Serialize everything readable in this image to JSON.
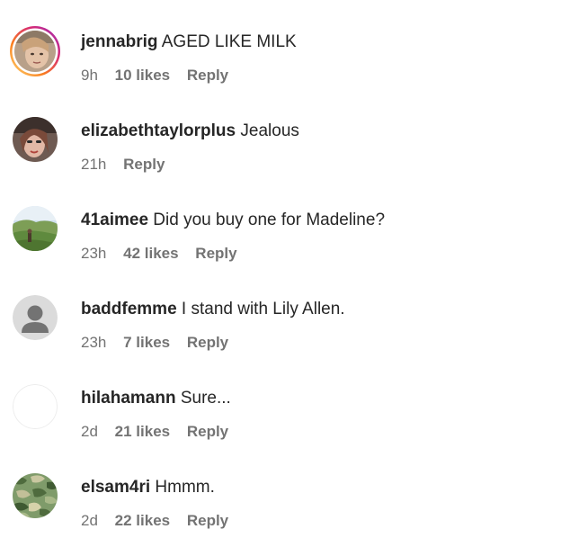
{
  "comments": [
    {
      "username": "jennabrig",
      "text": "AGED LIKE MILK",
      "time": "9h",
      "likes": "10 likes",
      "reply": "Reply",
      "avatar_icon": "profile-photo-story-ring-icon",
      "has_story_ring": true,
      "story_ring_colors": [
        "#feda75",
        "#fa7e1e",
        "#d62976",
        "#962fbf"
      ]
    },
    {
      "username": "elizabethtaylorplus",
      "text": "Jealous",
      "time": "21h",
      "likes": "",
      "reply": "Reply",
      "avatar_icon": "profile-photo-icon"
    },
    {
      "username": "41aimee",
      "text": "Did you buy one for Madeline?",
      "time": "23h",
      "likes": "42 likes",
      "reply": "Reply",
      "avatar_icon": "landscape-photo-icon"
    },
    {
      "username": "baddfemme",
      "text": "I stand with Lily Allen.",
      "time": "23h",
      "likes": "7 likes",
      "reply": "Reply",
      "avatar_icon": "default-user-icon"
    },
    {
      "username": "hilahamann",
      "text": "Sure...",
      "time": "2d",
      "likes": "21 likes",
      "reply": "Reply",
      "avatar_icon": "blank-avatar-icon"
    },
    {
      "username": "elsam4ri",
      "text": "Hmmm.",
      "time": "2d",
      "likes": "22 likes",
      "reply": "Reply",
      "avatar_icon": "camouflage-pattern-icon"
    }
  ],
  "colors": {
    "username_text": "#262626",
    "meta_text": "#737373",
    "default_avatar_bg": "#dbdbdb",
    "default_avatar_fg": "#ffffff"
  }
}
